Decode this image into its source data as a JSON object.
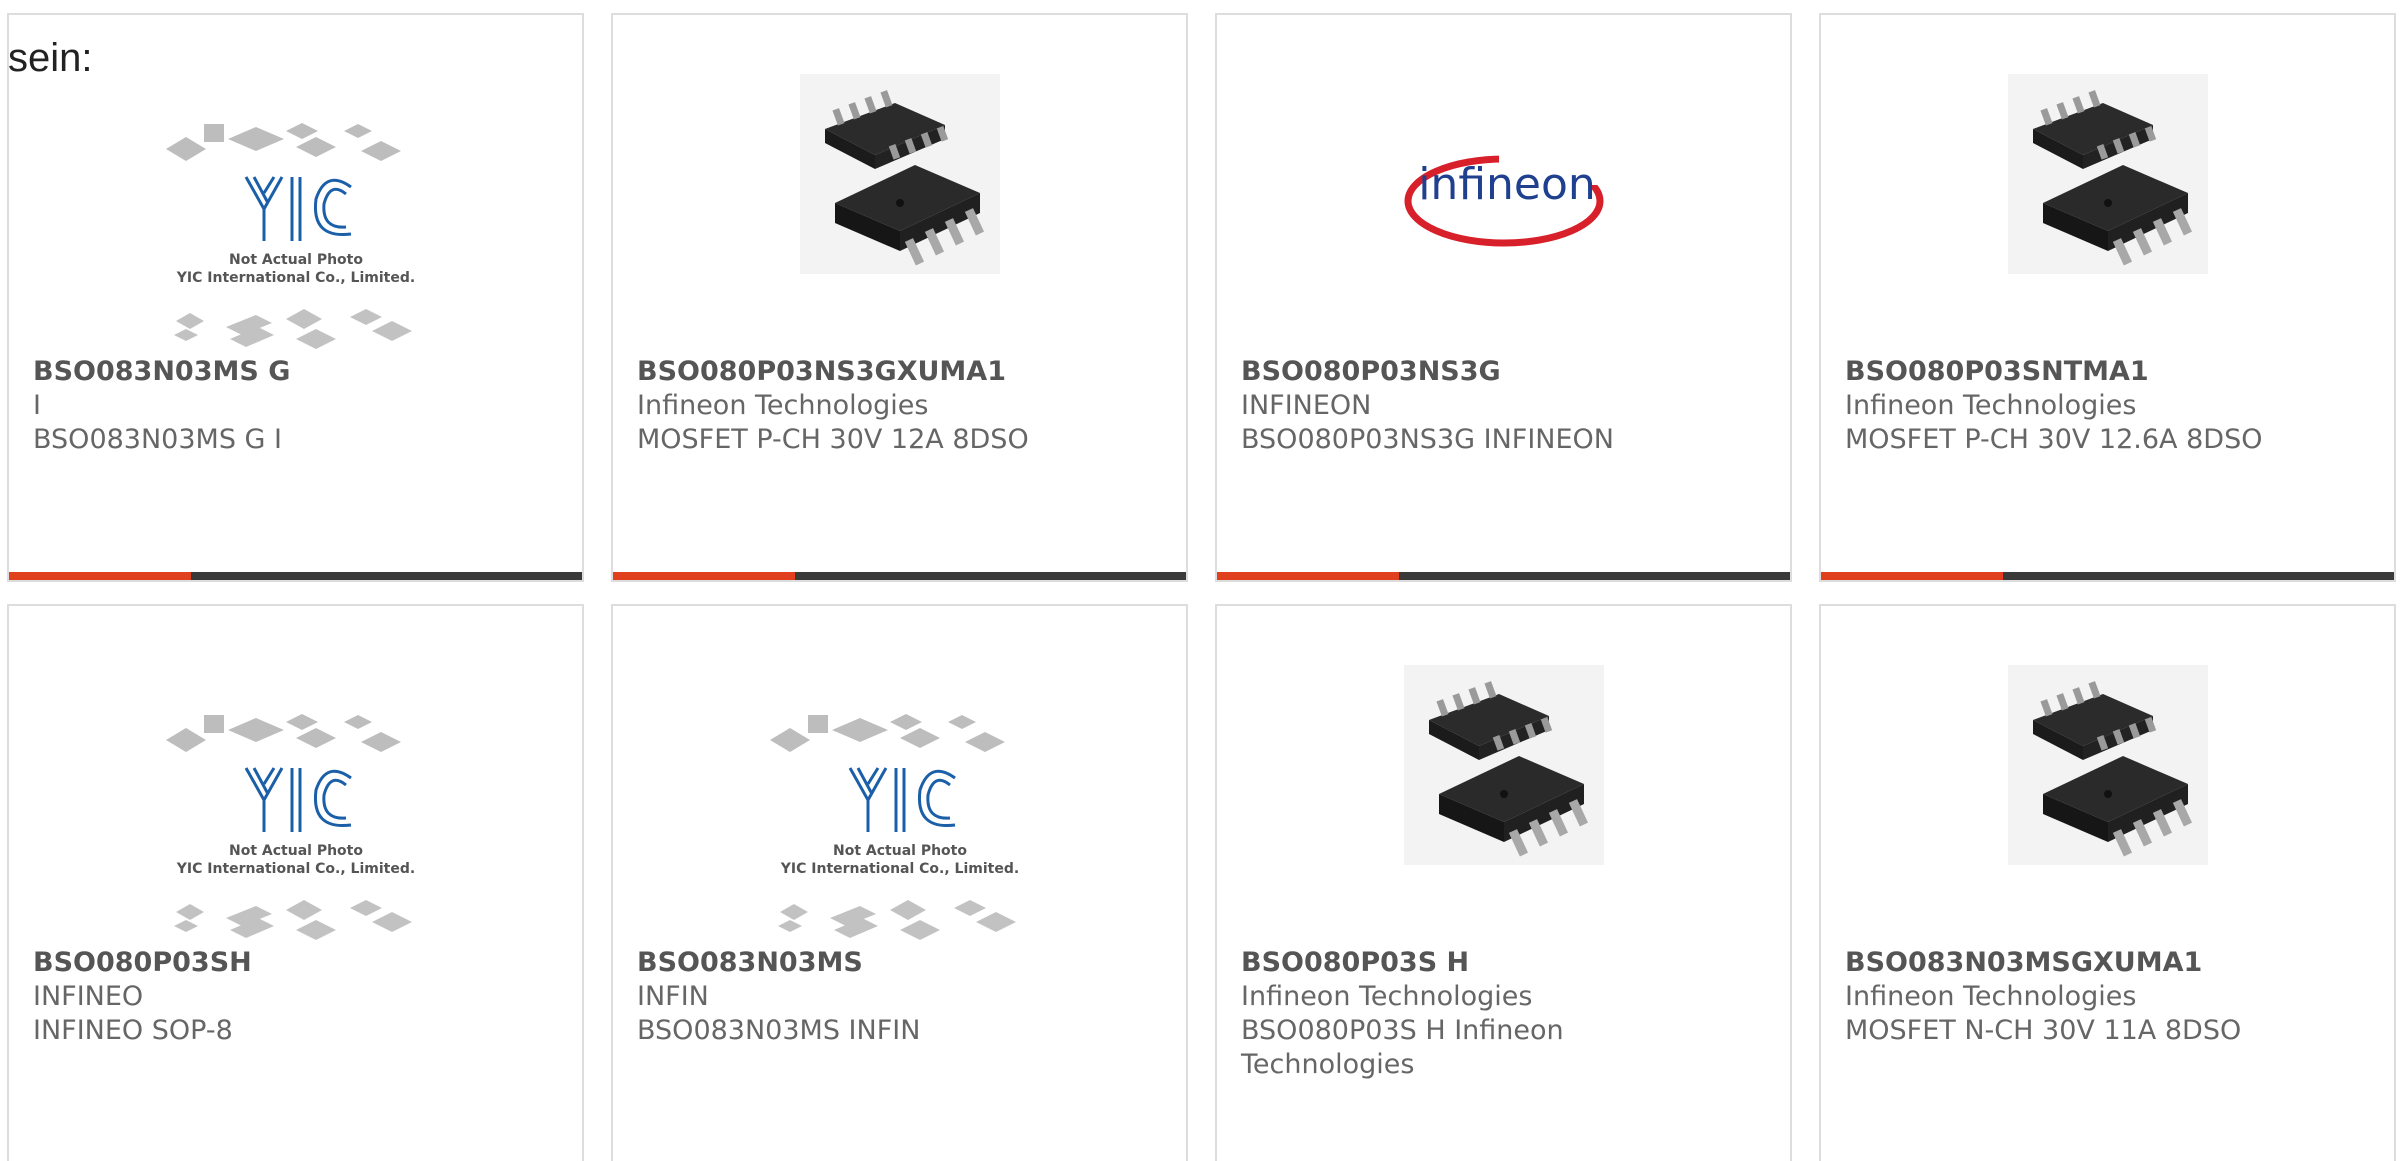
{
  "intro_text": "sein:",
  "products": [
    {
      "part": "BSO083N03MS G",
      "manufacturer": "I",
      "description": "BSO083N03MS G I",
      "image": "placeholder-photo-icon",
      "image_text": {
        "brand": "YIC",
        "line1": "Not Actual Photo",
        "line2": "YIC International Co., Limited."
      }
    },
    {
      "part": "BSO080P03NS3GXUMA1",
      "manufacturer": "Infineon Technologies",
      "description": "MOSFET P-CH 30V 12A 8DSO",
      "image": "soic8-chip-photo"
    },
    {
      "part": "BSO080P03NS3G",
      "manufacturer": "INFINEON",
      "description": "BSO080P03NS3G INFINEON",
      "image": "infineon-logo",
      "image_text": {
        "logo": "infineon"
      }
    },
    {
      "part": "BSO080P03SNTMA1",
      "manufacturer": "Infineon Technologies",
      "description": "MOSFET P-CH 30V 12.6A 8DSO",
      "image": "soic8-chip-photo"
    },
    {
      "part": "BSO080P03SH",
      "manufacturer": "INFINEO",
      "description": "INFINEO SOP-8",
      "image": "placeholder-photo-icon",
      "image_text": {
        "brand": "YIC",
        "line1": "Not Actual Photo",
        "line2": "YIC International Co., Limited."
      }
    },
    {
      "part": "BSO083N03MS",
      "manufacturer": "INFIN",
      "description": "BSO083N03MS INFIN",
      "image": "placeholder-photo-icon",
      "image_text": {
        "brand": "YIC",
        "line1": "Not Actual Photo",
        "line2": "YIC International Co., Limited."
      }
    },
    {
      "part": "BSO080P03S H",
      "manufacturer": "Infineon Technologies",
      "description": "BSO080P03S H Infineon Technologies",
      "image": "soic8-chip-photo"
    },
    {
      "part": "BSO083N03MSGXUMA1",
      "manufacturer": "Infineon Technologies",
      "description": "MOSFET N-CH 30V 11A 8DSO",
      "image": "soic8-chip-photo"
    }
  ],
  "colors": {
    "accent": "#e0401e",
    "bar": "#3a3a3a",
    "border": "#dddddd",
    "title_text": "#555555",
    "body_text": "#666666",
    "yic_blue": "#1a5fa8",
    "infineon_blue": "#1f3f8f",
    "infineon_red": "#d8202b"
  }
}
